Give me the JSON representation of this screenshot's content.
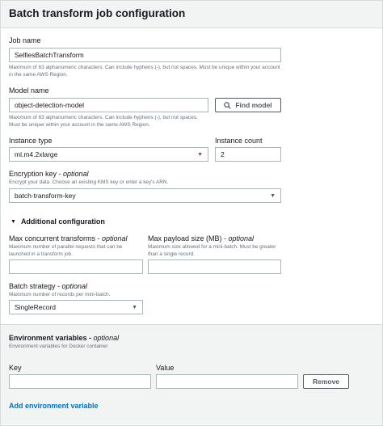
{
  "header": {
    "title": "Batch transform job configuration"
  },
  "job_name": {
    "label": "Job name",
    "value": "SelfiesBatchTransform",
    "hint": "Maximum of 63 alphanumeric characters. Can include hyphens (-), but not spaces. Must be unique within your account in the same AWS Region."
  },
  "model_name": {
    "label": "Model name",
    "value": "object-detection-model",
    "hint": "Maximum of 63 alphanumeric characters. Can include hyphens (-), but not spaces. Must be unique within your account in the same AWS Region.",
    "find_button": "Find model"
  },
  "instance_type": {
    "label": "Instance type",
    "value": "ml.m4.2xlarge"
  },
  "instance_count": {
    "label": "Instance count",
    "value": "2"
  },
  "encryption_key": {
    "label": "Encryption key - ",
    "optional": "optional",
    "hint": "Encrypt your data. Choose an existing KMS key or enter a key's ARN.",
    "value": "batch-transform-key"
  },
  "additional_config": {
    "label": "Additional configuration"
  },
  "max_concurrent": {
    "label": "Max concurrent transforms - ",
    "optional": "optional",
    "hint": "Maximum number of parallel requests that can be launched in a transform job.",
    "value": ""
  },
  "max_payload": {
    "label": "Max payload size (MB) - ",
    "optional": "optional",
    "hint": "Maximum size allowed for a mini-batch. Must be greater than a single record.",
    "value": ""
  },
  "batch_strategy": {
    "label": "Batch strategy - ",
    "optional": "optional",
    "hint": "Maximum number of records per mini-batch.",
    "value": "SingleRecord"
  },
  "env_vars": {
    "title": "Environment variables - ",
    "optional": "optional",
    "hint": "Environment variables for Docker container",
    "key_label": "Key",
    "value_label": "Value",
    "key_value": "",
    "value_value": "",
    "remove_button": "Remove",
    "add_link": "Add environment variable"
  }
}
